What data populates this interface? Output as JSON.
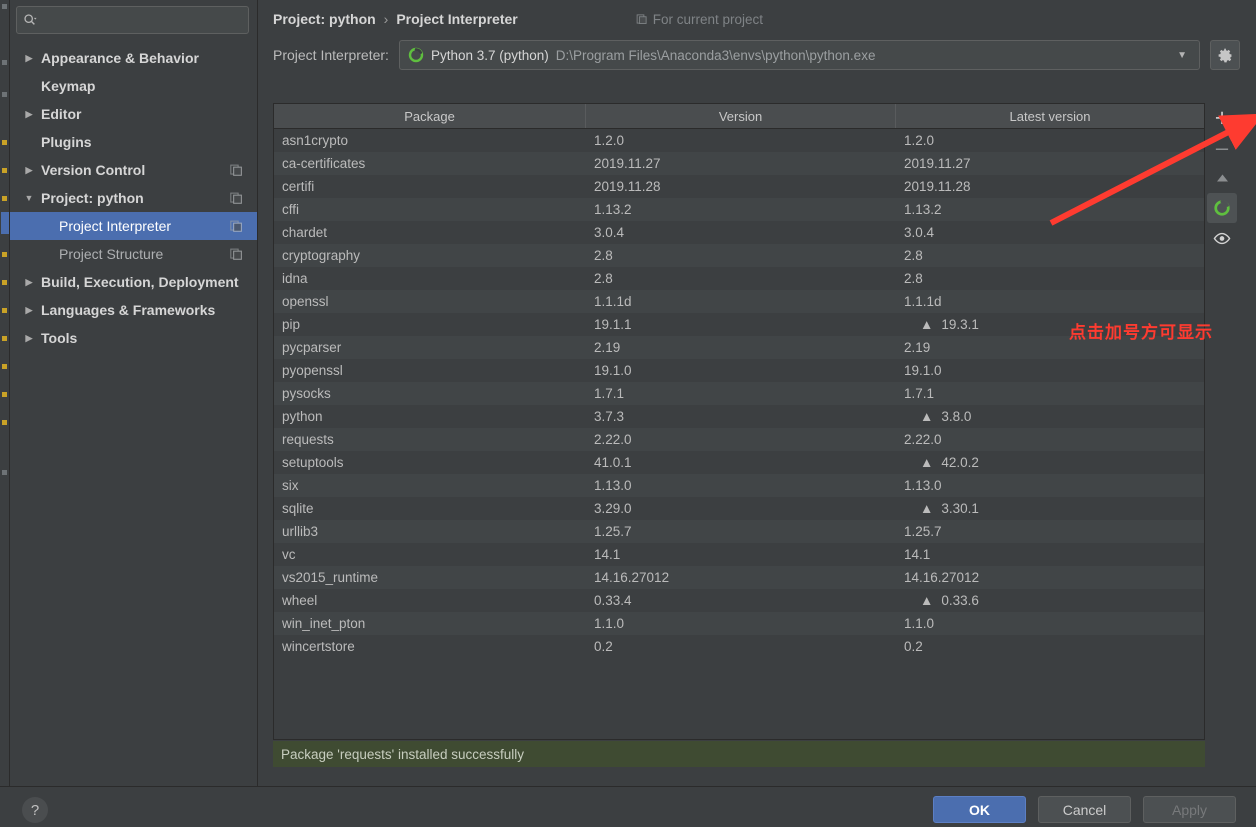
{
  "search": {
    "placeholder": "",
    "value": "",
    "icon": "search-icon"
  },
  "sidebar": {
    "items": [
      {
        "label": "Appearance & Behavior",
        "arrow": "▶",
        "bold": true,
        "child": false,
        "selected": false,
        "copy": false
      },
      {
        "label": "Keymap",
        "arrow": "",
        "bold": true,
        "child": false,
        "selected": false,
        "copy": false
      },
      {
        "label": "Editor",
        "arrow": "▶",
        "bold": true,
        "child": false,
        "selected": false,
        "copy": false
      },
      {
        "label": "Plugins",
        "arrow": "",
        "bold": true,
        "child": false,
        "selected": false,
        "copy": false
      },
      {
        "label": "Version Control",
        "arrow": "▶",
        "bold": true,
        "child": false,
        "selected": false,
        "copy": true
      },
      {
        "label": "Project: python",
        "arrow": "▼",
        "bold": true,
        "child": false,
        "selected": false,
        "copy": true
      },
      {
        "label": "Project Interpreter",
        "arrow": "",
        "bold": false,
        "child": true,
        "selected": true,
        "copy": true
      },
      {
        "label": "Project Structure",
        "arrow": "",
        "bold": false,
        "child": true,
        "selected": false,
        "copy": true
      },
      {
        "label": "Build, Execution, Deployment",
        "arrow": "▶",
        "bold": true,
        "child": false,
        "selected": false,
        "copy": false
      },
      {
        "label": "Languages & Frameworks",
        "arrow": "▶",
        "bold": true,
        "child": false,
        "selected": false,
        "copy": false
      },
      {
        "label": "Tools",
        "arrow": "▶",
        "bold": true,
        "child": false,
        "selected": false,
        "copy": false
      }
    ]
  },
  "header": {
    "breadcrumb_parent": "Project: python",
    "breadcrumb_sep": "›",
    "breadcrumb_current": "Project Interpreter",
    "for_current_project": "For current project"
  },
  "interpreter": {
    "label": "Project Interpreter:",
    "name": "Python 3.7 (python)",
    "path": "D:\\Program Files\\Anaconda3\\envs\\python\\python.exe",
    "dropdown_arrow": "▼",
    "gear_icon": "gear-icon",
    "env_icon": "conda-icon"
  },
  "table": {
    "columns": [
      "Package",
      "Version",
      "Latest version"
    ],
    "upgrade_marker": "▲",
    "rows": [
      {
        "package": "asn1crypto",
        "version": "1.2.0",
        "latest": "1.2.0",
        "upgradable": false
      },
      {
        "package": "ca-certificates",
        "version": "2019.11.27",
        "latest": "2019.11.27",
        "upgradable": false
      },
      {
        "package": "certifi",
        "version": "2019.11.28",
        "latest": "2019.11.28",
        "upgradable": false
      },
      {
        "package": "cffi",
        "version": "1.13.2",
        "latest": "1.13.2",
        "upgradable": false
      },
      {
        "package": "chardet",
        "version": "3.0.4",
        "latest": "3.0.4",
        "upgradable": false
      },
      {
        "package": "cryptography",
        "version": "2.8",
        "latest": "2.8",
        "upgradable": false
      },
      {
        "package": "idna",
        "version": "2.8",
        "latest": "2.8",
        "upgradable": false
      },
      {
        "package": "openssl",
        "version": "1.1.1d",
        "latest": "1.1.1d",
        "upgradable": false
      },
      {
        "package": "pip",
        "version": "19.1.1",
        "latest": "19.3.1",
        "upgradable": true
      },
      {
        "package": "pycparser",
        "version": "2.19",
        "latest": "2.19",
        "upgradable": false
      },
      {
        "package": "pyopenssl",
        "version": "19.1.0",
        "latest": "19.1.0",
        "upgradable": false
      },
      {
        "package": "pysocks",
        "version": "1.7.1",
        "latest": "1.7.1",
        "upgradable": false
      },
      {
        "package": "python",
        "version": "3.7.3",
        "latest": "3.8.0",
        "upgradable": true
      },
      {
        "package": "requests",
        "version": "2.22.0",
        "latest": "2.22.0",
        "upgradable": false
      },
      {
        "package": "setuptools",
        "version": "41.0.1",
        "latest": "42.0.2",
        "upgradable": true
      },
      {
        "package": "six",
        "version": "1.13.0",
        "latest": "1.13.0",
        "upgradable": false
      },
      {
        "package": "sqlite",
        "version": "3.29.0",
        "latest": "3.30.1",
        "upgradable": true
      },
      {
        "package": "urllib3",
        "version": "1.25.7",
        "latest": "1.25.7",
        "upgradable": false
      },
      {
        "package": "vc",
        "version": "14.1",
        "latest": "14.1",
        "upgradable": false
      },
      {
        "package": "vs2015_runtime",
        "version": "14.16.27012",
        "latest": "14.16.27012",
        "upgradable": false
      },
      {
        "package": "wheel",
        "version": "0.33.4",
        "latest": "0.33.6",
        "upgradable": true
      },
      {
        "package": "win_inet_pton",
        "version": "1.1.0",
        "latest": "1.1.0",
        "upgradable": false
      },
      {
        "package": "wincertstore",
        "version": "0.2",
        "latest": "0.2",
        "upgradable": false
      }
    ]
  },
  "toolbar": {
    "buttons": [
      {
        "name": "add-package-button",
        "glyph": "+",
        "icon": "plus-icon",
        "active": false
      },
      {
        "name": "remove-package-button",
        "glyph": "–",
        "icon": "minus-icon",
        "active": false
      },
      {
        "name": "upgrade-package-button",
        "glyph": "▲",
        "icon": "up-arrow-icon",
        "active": false
      },
      {
        "name": "conda-env-button",
        "glyph": "",
        "icon": "conda-icon",
        "active": true
      },
      {
        "name": "show-early-releases-button",
        "glyph": "",
        "icon": "eye-icon",
        "active": false
      }
    ]
  },
  "status": {
    "message": "Package 'requests' installed successfully"
  },
  "annotation": {
    "text": "点击加号方可显示",
    "color": "#fe3b30"
  },
  "footer": {
    "help_label": "?",
    "ok_label": "OK",
    "cancel_label": "Cancel",
    "apply_label": "Apply"
  },
  "colors": {
    "background": "#3c3f41",
    "selection": "#4b6eaf",
    "status_success_bg": "#3f4b32",
    "annotation_red": "#fe3b30",
    "conda_green": "#4caf50"
  }
}
